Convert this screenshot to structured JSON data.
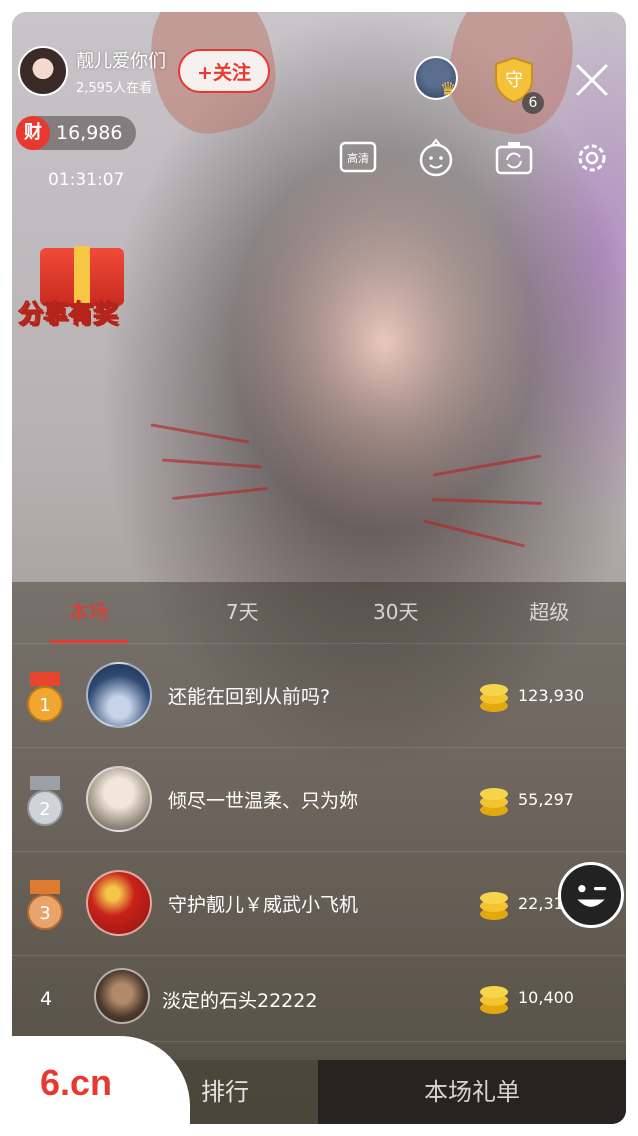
{
  "host": {
    "name": "靓儿爱你们",
    "viewers": "2,595人在看",
    "follow_label": "+关注"
  },
  "wealth": {
    "icon_label": "财",
    "value": "16,986"
  },
  "timer": "01:31:07",
  "guard": {
    "label": "守",
    "count": "6"
  },
  "tools": {
    "hd_label": "高清"
  },
  "share_promo": "分享有奖",
  "tabs": [
    "本场",
    "7天",
    "30天",
    "超级"
  ],
  "ranking": [
    {
      "rank": "1",
      "name": "还能在回到从前吗?",
      "value": "123,930"
    },
    {
      "rank": "2",
      "name": "倾尽一世温柔、只为妳",
      "value": "55,297"
    },
    {
      "rank": "3",
      "name": "守护靓儿￥威武小飞机",
      "value": "22,312"
    },
    {
      "rank": "4",
      "name": "淡定的石头22222",
      "value": "10,400"
    }
  ],
  "bottom": {
    "left_label": "排行",
    "right_label": "本场礼单"
  },
  "brand": "6.cn",
  "colors": {
    "accent": "#e8382f",
    "gold": "#f6c23b"
  }
}
